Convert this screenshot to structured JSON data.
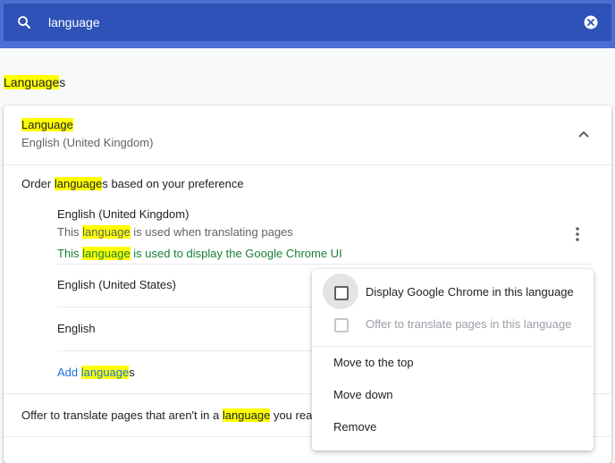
{
  "search": {
    "query": "language"
  },
  "section": {
    "title_highlight": "Language",
    "title_rest": "s"
  },
  "language_card": {
    "header_title": "Language",
    "header_subtitle": "English (United Kingdom)",
    "order_prefix": "Order ",
    "order_highlight": "language",
    "order_suffix": "s based on your preference",
    "languages": [
      {
        "name": "English (United Kingdom)",
        "line1_prefix": "This ",
        "line1_highlight": "language",
        "line1_suffix": " is used when translating pages",
        "line2_prefix": "This ",
        "line2_highlight": "language",
        "line2_suffix": " is used to display the Google Chrome UI"
      },
      {
        "name": "English (United States)"
      },
      {
        "name": "English"
      }
    ],
    "add_prefix": "Add ",
    "add_highlight": "language",
    "add_suffix": "s",
    "offer_prefix": "Offer to translate pages that aren't in a ",
    "offer_highlight": "language",
    "offer_suffix": " you read"
  },
  "context_menu": {
    "display_label": "Display Google Chrome in this language",
    "offer_label": "Offer to translate pages in this language",
    "move_top": "Move to the top",
    "move_down": "Move down",
    "remove": "Remove"
  },
  "colors": {
    "toolbar": "#4a6fd2",
    "search_field": "#2e52b8",
    "highlight": "#ffff00",
    "link": "#1a73e8",
    "ui_language_note": "#188038"
  }
}
